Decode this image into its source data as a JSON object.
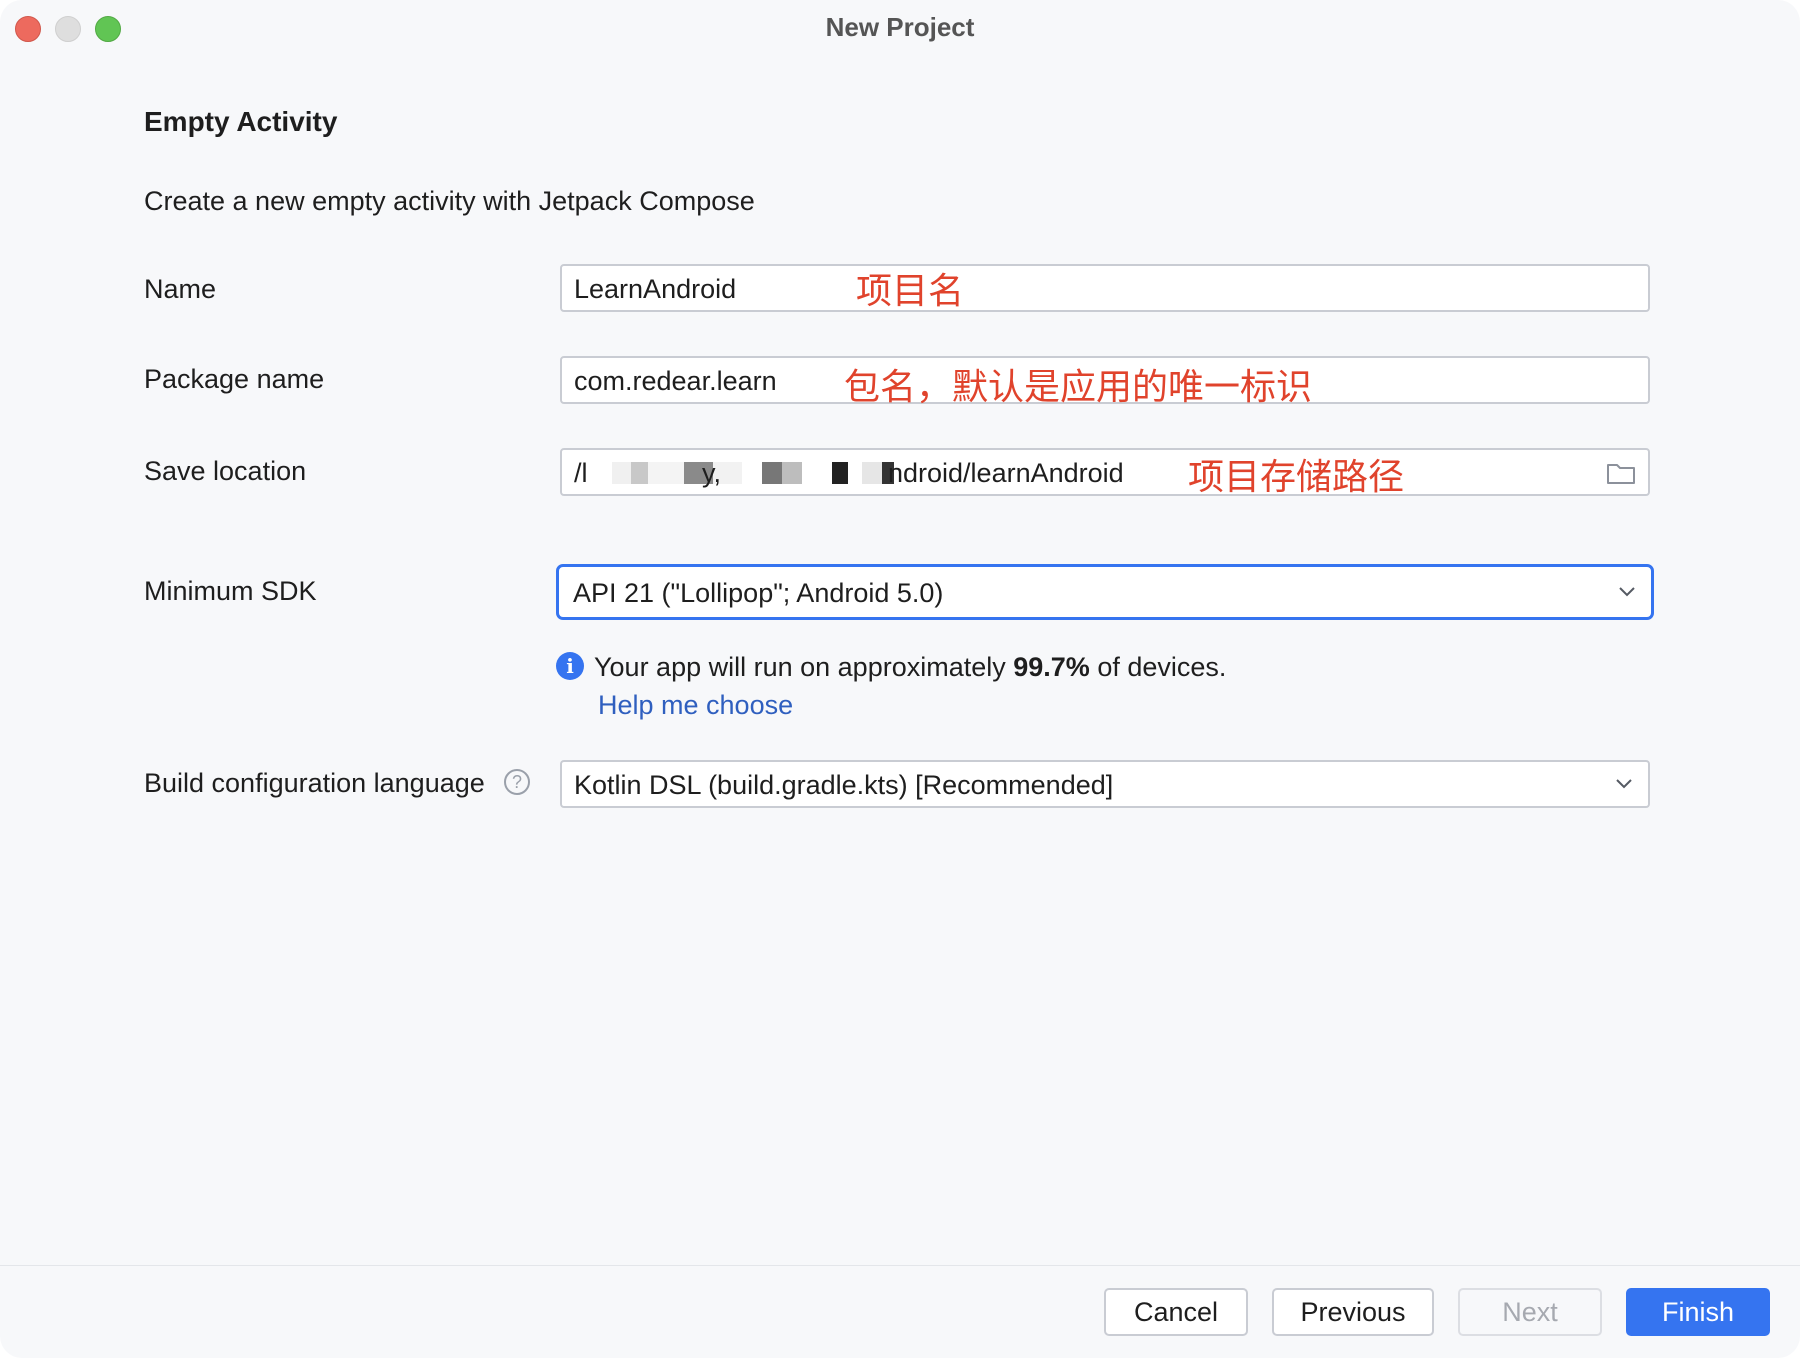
{
  "window": {
    "title": "New Project"
  },
  "template": {
    "heading": "Empty Activity",
    "description": "Create a new empty activity with Jetpack Compose"
  },
  "form": {
    "name": {
      "label": "Name",
      "value": "LearnAndroid",
      "annotation": "项目名"
    },
    "package": {
      "label": "Package name",
      "value": "com.redear.learn",
      "annotation": "包名，默认是应用的唯一标识"
    },
    "save_location": {
      "label": "Save location",
      "value_start": "/l",
      "value_mid1": "y,",
      "value_end": "ndroid/learnAndroid",
      "annotation": "项目存储路径",
      "icon": "folder-icon"
    },
    "min_sdk": {
      "label": "Minimum SDK",
      "value": "API 21 (\"Lollipop\"; Android 5.0)",
      "icon": "chevron-down-icon"
    },
    "sdk_info": {
      "icon": "info-icon",
      "prefix": "Your app will run on approximately ",
      "percent": "99.7%",
      "suffix": " of devices.",
      "link": "Help me choose"
    },
    "build_lang": {
      "label": "Build configuration language",
      "value": "Kotlin DSL (build.gradle.kts) [Recommended]",
      "help_icon": "question-icon"
    }
  },
  "footer": {
    "cancel": "Cancel",
    "previous": "Previous",
    "next": "Next",
    "finish": "Finish"
  },
  "colors": {
    "accent": "#3574f0",
    "annotation": "#e0432c",
    "link": "#2f5fbf"
  }
}
